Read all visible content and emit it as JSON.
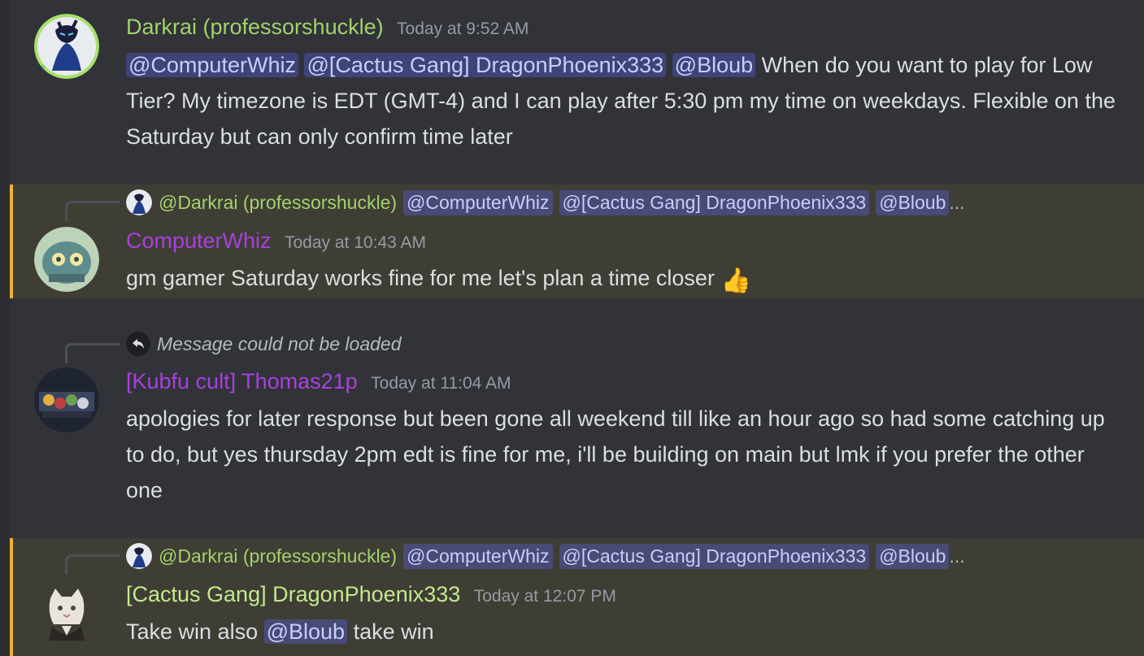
{
  "colors": {
    "background": "#313338",
    "highlight_background": "#3f3e35",
    "highlight_bar": "#f0b232",
    "mention_bg": "#4f5493",
    "author_green": "#a3d26c",
    "author_purple": "#a940de",
    "author_lightgreen": "#c3e88d"
  },
  "messages": [
    {
      "author": "Darkrai (professorshuckle)",
      "timestamp": "Today at 9:52 AM",
      "mentions": [
        "@ComputerWhiz",
        "@[Cactus Gang] DragonPhoenix333",
        "@Bloub"
      ],
      "text_line1": "When do you want to",
      "text_rest": "play for Low Tier? My timezone is EDT (GMT-4) and I can play after 5:30 pm my time on weekdays. Flexible on the Saturday but can only confirm time later",
      "avatar_icon": "darkrai-avatar-icon"
    },
    {
      "reply": {
        "author": "@Darkrai (professorshuckle)",
        "mentions": [
          "@ComputerWhiz",
          "@[Cactus Gang] DragonPhoenix333",
          "@Bloub"
        ],
        "ellipsis": "..."
      },
      "author": "ComputerWhiz",
      "timestamp": "Today at 10:43 AM",
      "text": "gm gamer Saturday works fine for me let's plan a time closer",
      "emoji": "👍",
      "avatar_icon": "computerwhiz-avatar-icon"
    },
    {
      "reply": {
        "unloaded_text": "Message could not be loaded"
      },
      "author": "[Kubfu cult] Thomas21p",
      "timestamp": "Today at 11:04 AM",
      "text": "apologies for later response but been gone all weekend till like an hour ago so had some catching up to do, but yes thursday 2pm edt is fine for me, i'll be building on main but lmk if you prefer the other one",
      "avatar_icon": "thomas-avatar-icon"
    },
    {
      "reply": {
        "author": "@Darkrai (professorshuckle)",
        "mentions": [
          "@ComputerWhiz",
          "@[Cactus Gang] DragonPhoenix333",
          "@Bloub"
        ],
        "ellipsis": "..."
      },
      "author": "[Cactus Gang] DragonPhoenix333",
      "timestamp": "Today at 12:07 PM",
      "text_before": "Take win also",
      "mention": "@Bloub",
      "text_after": "take win",
      "avatar_icon": "cat-avatar-icon"
    }
  ]
}
